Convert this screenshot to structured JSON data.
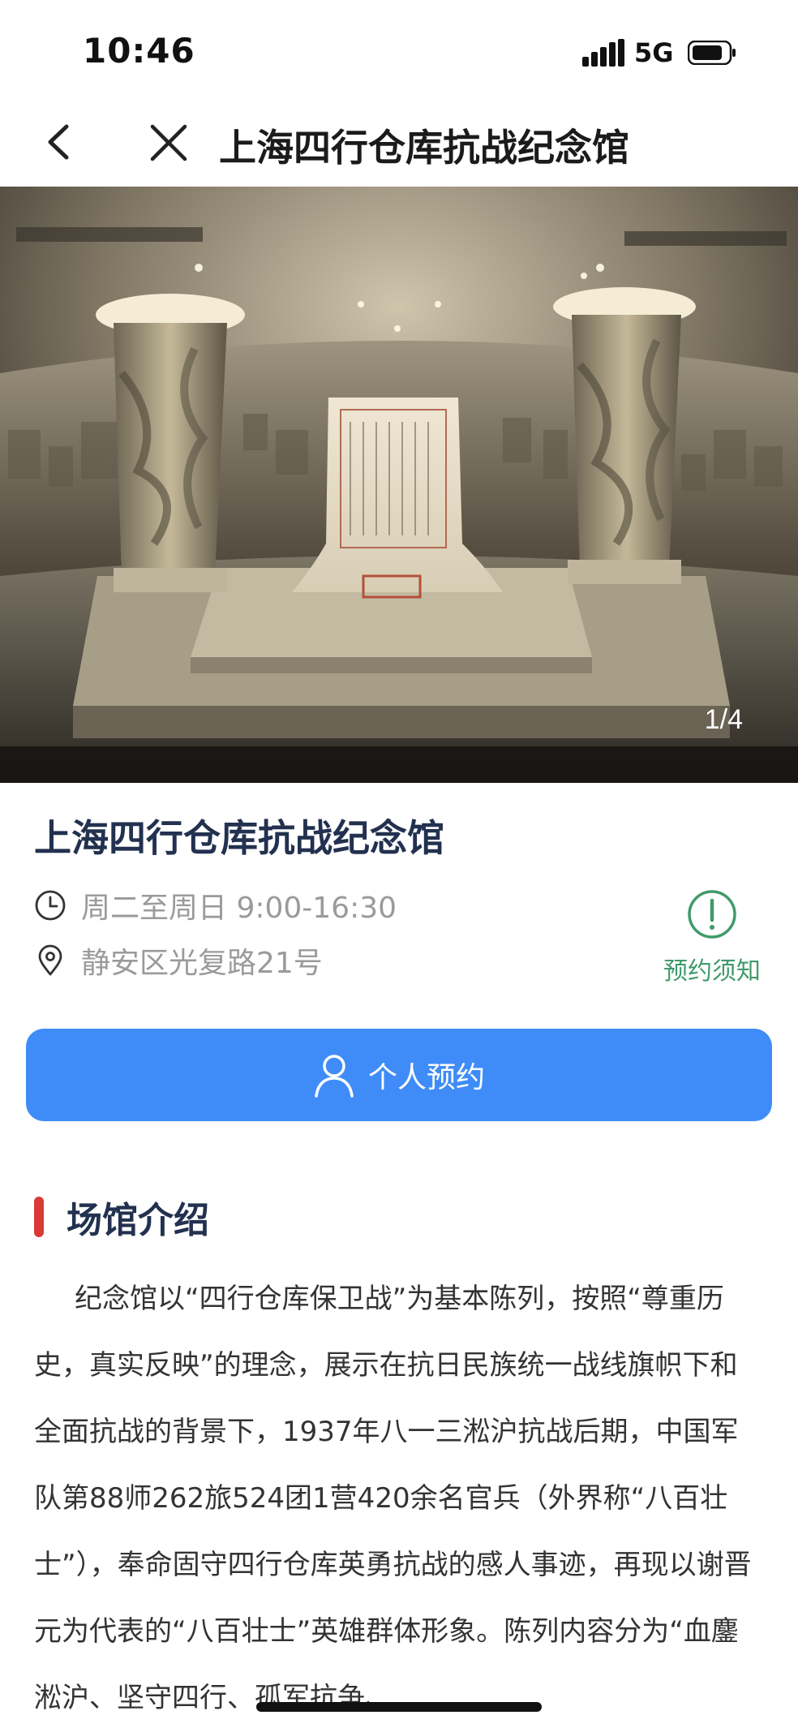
{
  "status_bar": {
    "time": "10:46",
    "network": "5G",
    "icons": [
      "signal-icon",
      "battery-icon"
    ]
  },
  "nav": {
    "title": "上海四行仓库抗战纪念馆",
    "icons": [
      "back-icon",
      "close-icon"
    ]
  },
  "gallery": {
    "counter": "1/4"
  },
  "venue": {
    "title": "上海四行仓库抗战纪念馆",
    "hours": "周二至周日 9:00-16:30",
    "address": "静安区光复路21号",
    "notice_label": "预约须知",
    "icons": [
      "clock-icon",
      "location-icon",
      "notice-icon"
    ]
  },
  "booking": {
    "label": "个人预约",
    "icon": "person-icon"
  },
  "intro": {
    "heading": "场馆介绍",
    "text": "纪念馆以“四行仓库保卫战”为基本陈列，按照“尊重历史，真实反映”的理念，展示在抗日民族统一战线旗帜下和全面抗战的背景下，1937年八一三淞沪抗战后期，中国军队第88师262旅524团1营420余名官兵（外界称“八百壮士”），奉命固守四行仓库英勇抗战的感人事迹，再现以谢晋元为代表的“八百壮士”英雄群体形象。陈列内容分为“血鏖淞沪、坚守四行、孤军抗争、"
  },
  "colors": {
    "primary_button": "#3f8cf8",
    "title_navy": "#22314f",
    "notice_green": "#3f9b6b",
    "section_accent": "#d93a35",
    "muted_text": "#9a9a9a"
  }
}
